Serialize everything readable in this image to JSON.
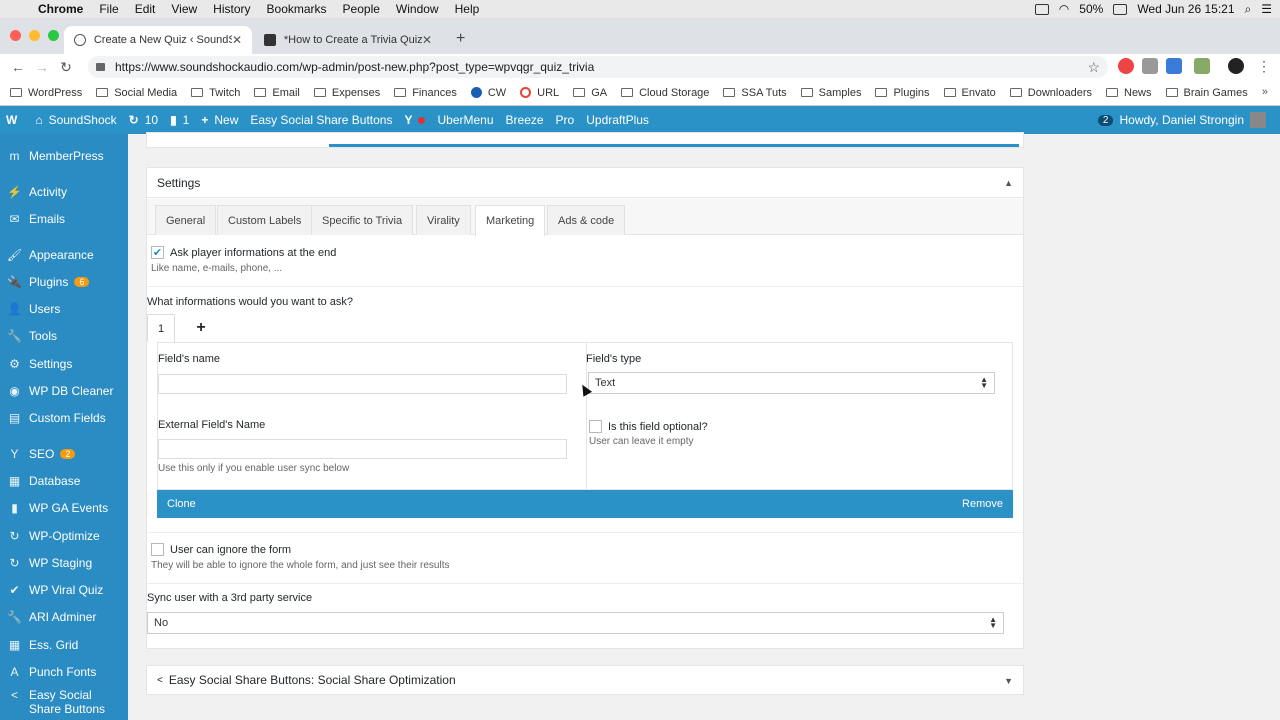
{
  "os_menu": {
    "app": "Chrome",
    "items": [
      "File",
      "Edit",
      "View",
      "History",
      "Bookmarks",
      "People",
      "Window",
      "Help"
    ],
    "battery": "50%",
    "clock": "Wed Jun 26  15:21"
  },
  "browser": {
    "tabs": [
      {
        "title": "Create a New Quiz ‹ SoundSho",
        "active": true
      },
      {
        "title": "*How to Create a Trivia Quiz w",
        "active": false
      }
    ],
    "url": "https://www.soundshockaudio.com/wp-admin/post-new.php?post_type=wpvqgr_quiz_trivia",
    "bookmarks": [
      {
        "label": "WordPress",
        "kind": "folder"
      },
      {
        "label": "Social Media",
        "kind": "folder"
      },
      {
        "label": "Twitch",
        "kind": "folder"
      },
      {
        "label": "Email",
        "kind": "folder"
      },
      {
        "label": "Expenses",
        "kind": "folder"
      },
      {
        "label": "Finances",
        "kind": "folder"
      },
      {
        "label": "CW",
        "kind": "cloud"
      },
      {
        "label": "URL",
        "kind": "google"
      },
      {
        "label": "GA",
        "kind": "folder"
      },
      {
        "label": "Cloud Storage",
        "kind": "folder"
      },
      {
        "label": "SSA Tuts",
        "kind": "folder"
      },
      {
        "label": "Samples",
        "kind": "folder"
      },
      {
        "label": "Plugins",
        "kind": "folder"
      },
      {
        "label": "Envato",
        "kind": "folder"
      },
      {
        "label": "Downloaders",
        "kind": "folder"
      },
      {
        "label": "News",
        "kind": "folder"
      },
      {
        "label": "Brain Games",
        "kind": "folder"
      }
    ]
  },
  "adminbar": {
    "site": "SoundShock",
    "updates": "10",
    "comments": "1",
    "new": "New",
    "essb": "Easy Social Share Buttons",
    "ubermenu": "UberMenu",
    "breeze": "Breeze",
    "pro": "Pro",
    "updraft": "UpdraftPlus",
    "notifications": "2",
    "howdy": "Howdy, Daniel Strongin"
  },
  "sidebar": {
    "items": [
      {
        "label": "MemberPress",
        "icon": "m",
        "count": ""
      },
      {
        "label": "Activity",
        "icon": "⚡",
        "count": ""
      },
      {
        "label": "Emails",
        "icon": "✉",
        "count": ""
      },
      {
        "label": "Appearance",
        "icon": "🖌",
        "count": ""
      },
      {
        "label": "Plugins",
        "icon": "🔌",
        "count": "6"
      },
      {
        "label": "Users",
        "icon": "👤",
        "count": ""
      },
      {
        "label": "Tools",
        "icon": "🔧",
        "count": ""
      },
      {
        "label": "Settings",
        "icon": "⚙",
        "count": ""
      },
      {
        "label": "WP DB Cleaner",
        "icon": "◉",
        "count": ""
      },
      {
        "label": "Custom Fields",
        "icon": "▤",
        "count": ""
      },
      {
        "label": "SEO",
        "icon": "Y",
        "count": "2"
      },
      {
        "label": "Database",
        "icon": "▦",
        "count": ""
      },
      {
        "label": "WP GA Events",
        "icon": "▮",
        "count": ""
      },
      {
        "label": "WP-Optimize",
        "icon": "↻",
        "count": ""
      },
      {
        "label": "WP Staging",
        "icon": "↻",
        "count": ""
      },
      {
        "label": "WP Viral Quiz",
        "icon": "✔",
        "count": ""
      },
      {
        "label": "ARI Adminer",
        "icon": "🔧",
        "count": ""
      },
      {
        "label": "Ess. Grid",
        "icon": "▦",
        "count": ""
      },
      {
        "label": "Punch Fonts",
        "icon": "A",
        "count": ""
      },
      {
        "label": "Easy Social Share Buttons",
        "icon": "<",
        "count": ""
      }
    ]
  },
  "settings": {
    "title": "Settings",
    "tabs": [
      "General",
      "Custom Labels",
      "Specific to Trivia",
      "Virality",
      "Marketing",
      "Ads & code"
    ],
    "active_tab": "Marketing",
    "ask_player": {
      "label": "Ask player informations at the end",
      "hint": "Like name, e-mails, phone, ...",
      "checked": true
    },
    "question": "What informations would you want to ask?",
    "field_tab": "1",
    "add_tab": "+",
    "field_name_label": "Field's name",
    "field_name_value": "",
    "field_type_label": "Field's type",
    "field_type_value": "Text",
    "external_label": "External Field's Name",
    "external_value": "",
    "external_hint": "Use this only if you enable user sync below",
    "optional_label": "Is this field optional?",
    "optional_hint": "User can leave it empty",
    "clone": "Clone",
    "remove": "Remove",
    "ignore_label": "User can ignore the form",
    "ignore_hint": "They will be able to ignore the whole form, and just see their results",
    "sync_label": "Sync user with a 3rd party service",
    "sync_value": "No"
  },
  "essb_panel": {
    "title": "Easy Social Share Buttons: Social Share Optimization"
  }
}
